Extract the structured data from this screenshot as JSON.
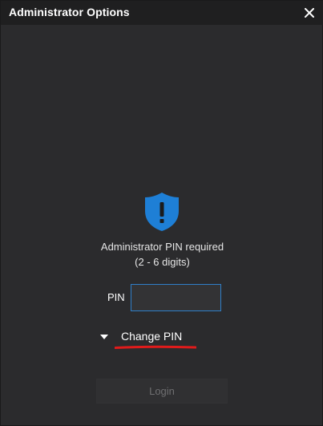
{
  "window": {
    "title": "Administrator Options",
    "close_icon": "close-icon"
  },
  "prompt": {
    "icon": "shield-exclamation-icon",
    "line1": "Administrator PIN required",
    "line2": "(2 - 6 digits)"
  },
  "pin": {
    "label": "PIN",
    "value": "",
    "placeholder": ""
  },
  "change_pin": {
    "label": "Change PIN",
    "expander_icon": "caret-down-icon"
  },
  "login": {
    "label": "Login",
    "enabled": false
  },
  "colors": {
    "background": "#2b2b2d",
    "titlebar": "#1f1f20",
    "accent_blue": "#1e7fd6",
    "input_border": "#2f7fc8",
    "annotation_red": "#e01b1b"
  }
}
